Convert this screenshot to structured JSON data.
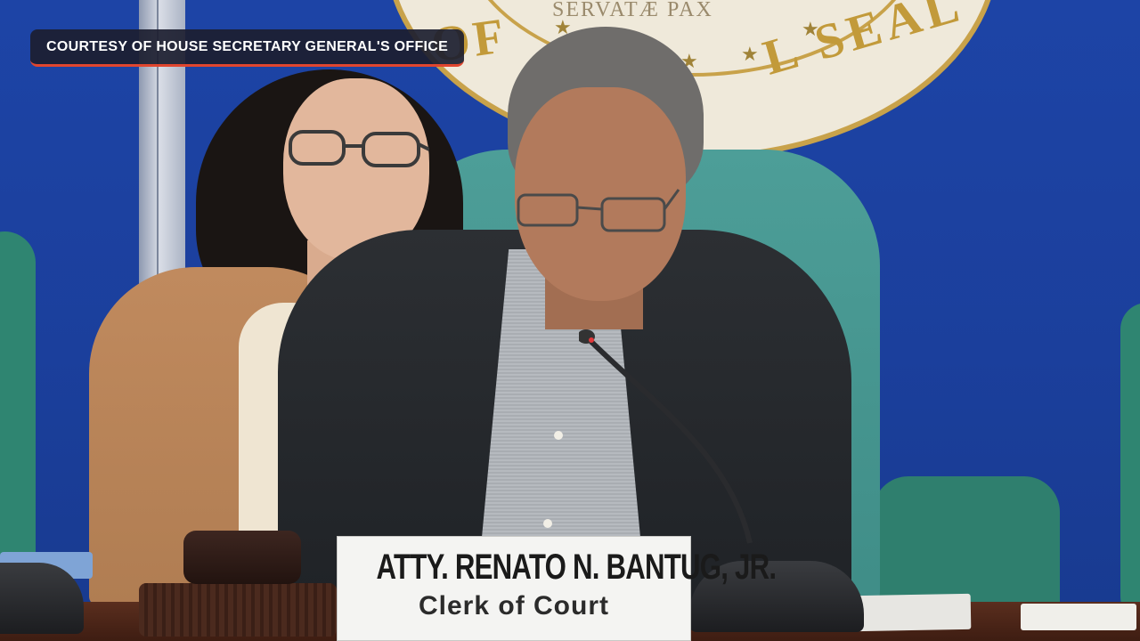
{
  "caption": {
    "text": "COURTESY OF HOUSE SECRETARY GENERAL'S OFFICE",
    "accent_color": "#e0462f"
  },
  "seal": {
    "motto": "SERVATÆ PAX",
    "ring_text_left": "OF",
    "ring_text_right": "L SEAL"
  },
  "nameplate": {
    "name": "ATTY. RENATO N. BANTUG, JR.",
    "title": "Clerk of Court"
  },
  "scene": {
    "description_icons": [
      "microphone-icon",
      "gavel-icon"
    ],
    "wall_color": "#1d44a6",
    "chair_color": "#4d9e98"
  }
}
